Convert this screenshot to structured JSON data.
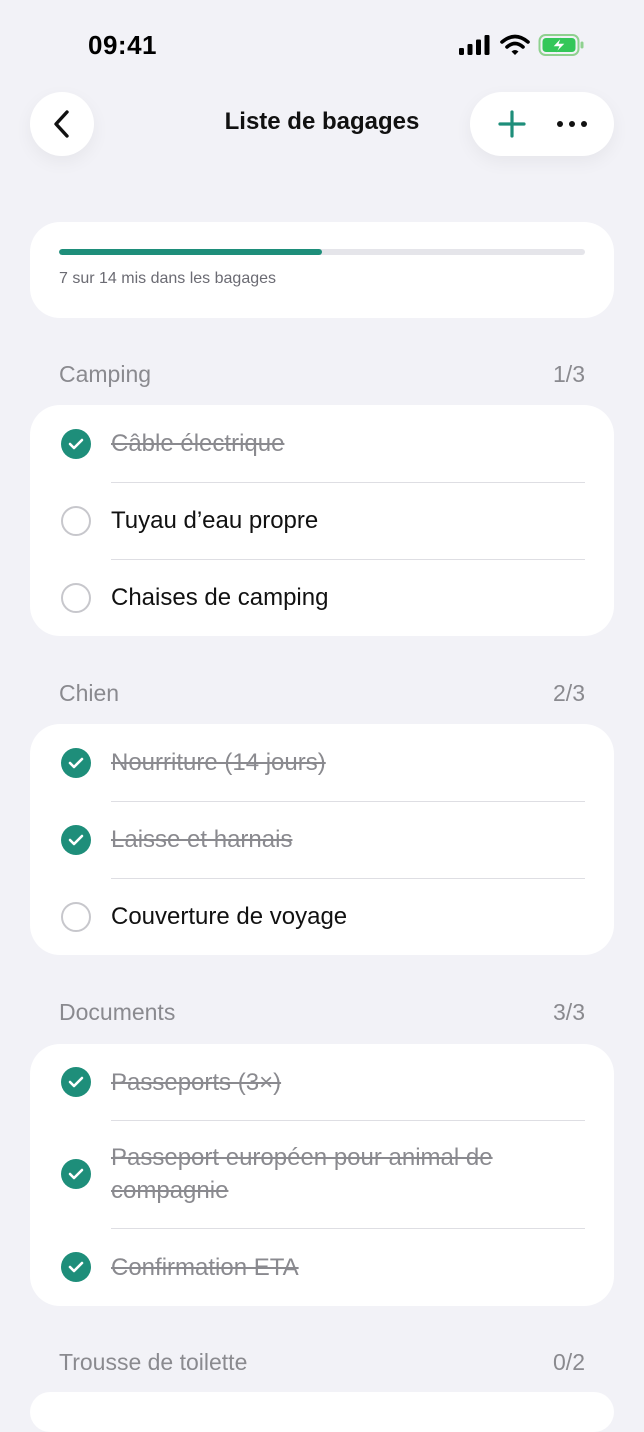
{
  "status_bar": {
    "time": "09:41"
  },
  "nav": {
    "title": "Liste de bagages"
  },
  "progress": {
    "packed": 7,
    "total": 14,
    "fraction": 0.5,
    "text": "7 sur 14 mis dans les bagages"
  },
  "colors": {
    "accent": "#1e8e7a",
    "background": "#f2f2f7"
  },
  "sections": [
    {
      "title": "Camping",
      "count": "1/3",
      "items": [
        {
          "label": "Câble électrique",
          "checked": true
        },
        {
          "label": "Tuyau d’eau propre",
          "checked": false
        },
        {
          "label": "Chaises de camping",
          "checked": false
        }
      ]
    },
    {
      "title": "Chien",
      "count": "2/3",
      "items": [
        {
          "label": "Nourriture (14 jours)",
          "checked": true
        },
        {
          "label": "Laisse et harnais",
          "checked": true
        },
        {
          "label": "Couverture de voyage",
          "checked": false
        }
      ]
    },
    {
      "title": "Documents",
      "count": "3/3",
      "items": [
        {
          "label": "Passeports (3×)",
          "checked": true
        },
        {
          "label": "Passeport européen pour animal de compagnie",
          "checked": true
        },
        {
          "label": "Confirmation ETA",
          "checked": true
        }
      ]
    },
    {
      "title": "Trousse de toilette",
      "count": "0/2",
      "items": []
    }
  ]
}
